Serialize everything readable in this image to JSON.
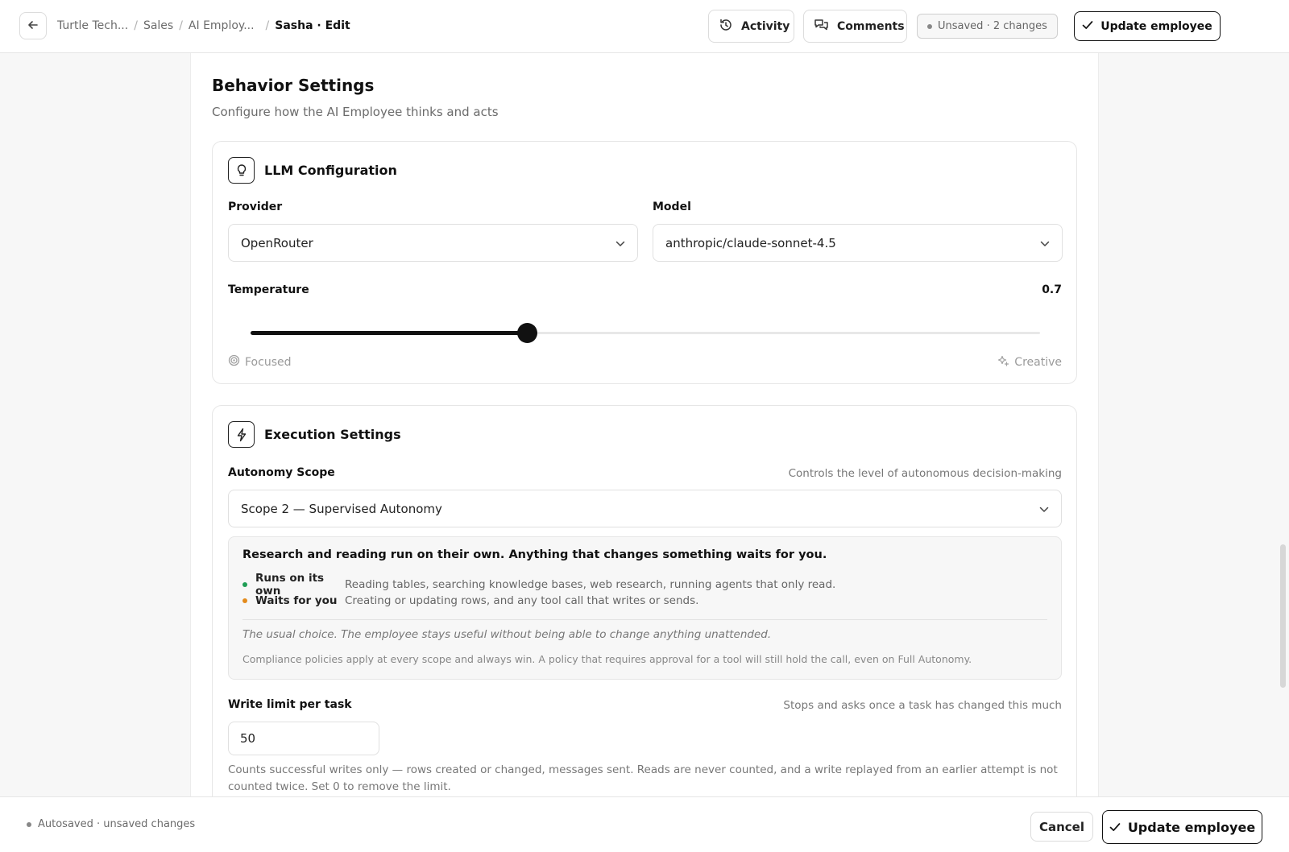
{
  "topbar": {
    "back_icon": "arrow-left-icon",
    "breadcrumb": [
      "Turtle Tech...",
      "Sales",
      "AI Employ...",
      "Sasha · Edit"
    ],
    "activity_label": "Activity",
    "activity_icon": "history-icon",
    "comments_label": "Comments",
    "comments_icon": "comments-icon",
    "unsaved_label": "Unsaved · 2 changes",
    "update_label": "Update employee",
    "update_icon": "check-icon"
  },
  "section": {
    "title": "Behavior Settings",
    "subtitle": "Configure how the AI Employee thinks and acts"
  },
  "llm": {
    "title": "LLM Configuration",
    "icon": "lightbulb-icon",
    "provider_label": "Provider",
    "provider_value": "OpenRouter",
    "model_label": "Model",
    "model_value": "anthropic/claude-sonnet-4.5",
    "temperature_label": "Temperature",
    "temperature_value": "0.7",
    "temperature_fraction": 0.35,
    "focused_label": "Focused",
    "focused_icon": "target-icon",
    "creative_label": "Creative",
    "creative_icon": "sparkles-icon"
  },
  "execution": {
    "title": "Execution Settings",
    "icon": "lightning-icon",
    "autonomy_label": "Autonomy Scope",
    "autonomy_hint": "Controls the level of autonomous decision-making",
    "autonomy_value": "Scope 2 — Supervised Autonomy",
    "desc_heading": "Research and reading run on their own. Anything that changes something waits for you.",
    "bullets": [
      {
        "label": "Runs on its own",
        "text": "Reading tables, searching knowledge bases, web research, running agents that only read.",
        "color": "#1f9d55"
      },
      {
        "label": "Waits for you",
        "text": "Creating or updating rows, and any tool call that writes or sends.",
        "color": "#e38b1c"
      }
    ],
    "desc_italic": "The usual choice. The employee stays useful without being able to change anything unattended.",
    "desc_note": "Compliance policies apply at every scope and always win. A policy that requires approval for a tool will still hold the call, even on Full Autonomy.",
    "write_limit_label": "Write limit per task",
    "write_limit_hint": "Stops and asks once a task has changed this much",
    "write_limit_value": "50",
    "write_limit_help": "Counts successful writes only — rows created or changed, messages sent. Reads are never counted, and a write replayed from an earlier attempt is not counted twice. Set 0 to remove the limit."
  },
  "bottombar": {
    "autosave_label": "Autosaved · unsaved changes",
    "cancel_label": "Cancel",
    "update_label": "Update employee"
  },
  "colors": {
    "accent": "#111111",
    "muted_bg": "#f7f7f7",
    "border": "#e6e6e6"
  }
}
